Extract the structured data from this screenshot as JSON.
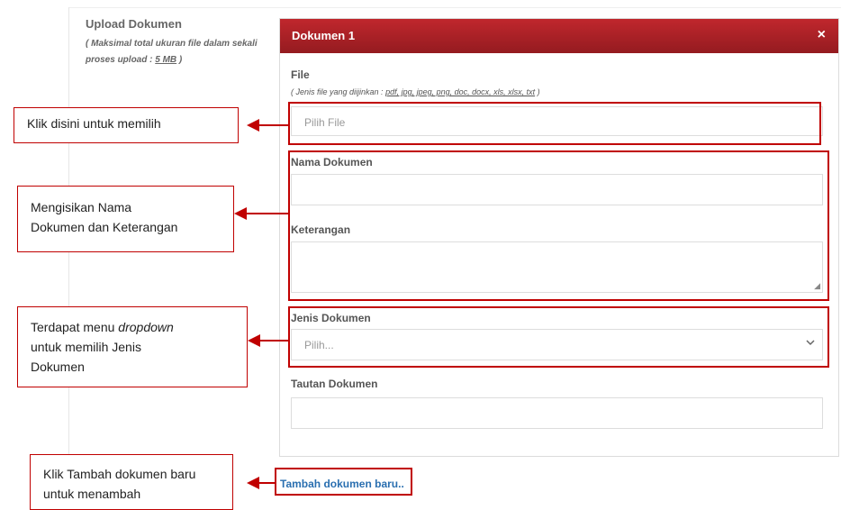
{
  "upload": {
    "title": "Upload Dokumen",
    "note_line1": "( Maksimal total ukuran file dalam sekali",
    "note_line2_prefix": "proses upload : ",
    "note_size": "5 MB",
    "note_line2_suffix": " )"
  },
  "panel": {
    "title": "Dokumen 1",
    "close_icon": "×"
  },
  "form": {
    "file_label": "File",
    "file_note_prefix": "( Jenis file yang diijinkan : ",
    "file_types": "pdf, jpg, jpeg, png, doc, docx, xls, xlsx, txt",
    "file_note_suffix": " )",
    "file_placeholder": "Pilih File",
    "nama_label": "Nama Dokumen",
    "keterangan_label": "Keterangan",
    "jenis_label": "Jenis Dokumen",
    "jenis_selected": "Pilih...",
    "tautan_label": "Tautan Dokumen",
    "add_link": "Tambah dokumen baru.."
  },
  "callouts": {
    "pilih": "Klik disini untuk memilih",
    "isi_line1": "Mengisikan Nama",
    "isi_line2": "Dokumen dan Keterangan",
    "dropdown_pre": "Terdapat menu ",
    "dropdown_em": "dropdown",
    "dropdown_line2": "untuk memilih Jenis",
    "dropdown_line3": "Dokumen",
    "tambah_line1": "Klik Tambah dokumen baru",
    "tambah_line2": "untuk menambah"
  },
  "colors": {
    "header_red": "#b02228",
    "highlight_red": "#c00000",
    "link_blue": "#2a6fb0"
  }
}
